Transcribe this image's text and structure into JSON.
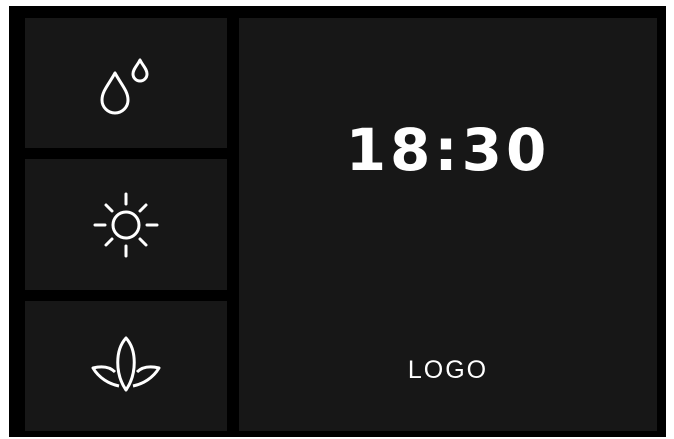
{
  "sidebar": {
    "items": [
      {
        "id": "water",
        "icon": "water-drops-icon"
      },
      {
        "id": "light",
        "icon": "sun-icon"
      },
      {
        "id": "wellness",
        "icon": "lotus-icon"
      }
    ]
  },
  "main": {
    "time": "18:30",
    "logo_text": "LOGO"
  },
  "colors": {
    "frame": "#000000",
    "tile": "#171717",
    "foreground": "#ffffff"
  }
}
